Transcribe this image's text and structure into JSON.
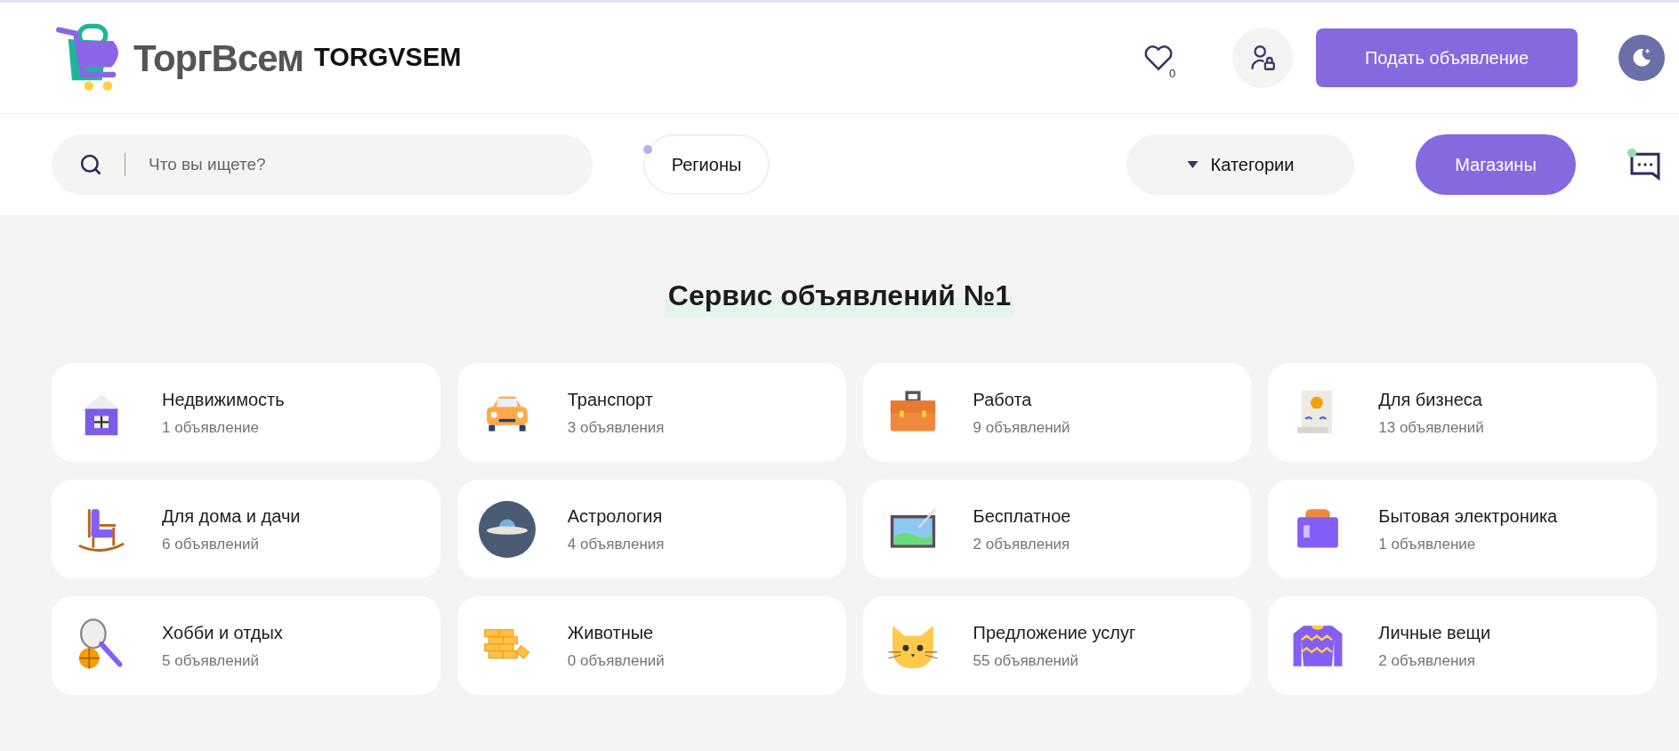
{
  "header": {
    "logo_text": "ТоргВсем",
    "site_name": "TORGVSEM",
    "favorites_count": "0",
    "post_button": "Подать объявление"
  },
  "toolbar": {
    "search": {
      "placeholder": "Что вы ищете?"
    },
    "regions_button": "Регионы",
    "categories_button": "Категории",
    "shops_button": "Магазины"
  },
  "headline": "Сервис объявлений №1",
  "categories": [
    {
      "name": "Недвижимость",
      "count": "1 объявление"
    },
    {
      "name": "Транспорт",
      "count": "3 объявления"
    },
    {
      "name": "Работа",
      "count": "9 объявлений"
    },
    {
      "name": "Для бизнеса",
      "count": "13 объявлений"
    },
    {
      "name": "Для дома и дачи",
      "count": "6 объявлений"
    },
    {
      "name": "Астрология",
      "count": "4 объявления"
    },
    {
      "name": "Бесплатное",
      "count": "2 объявления"
    },
    {
      "name": "Бытовая электроника",
      "count": "1 объявление"
    },
    {
      "name": "Хобби и отдых",
      "count": "5 объявлений"
    },
    {
      "name": "Животные",
      "count": "0 объявлений"
    },
    {
      "name": "Предложение услуг",
      "count": "55 объявлений"
    },
    {
      "name": "Личные вещи",
      "count": "2 объявления"
    }
  ]
}
